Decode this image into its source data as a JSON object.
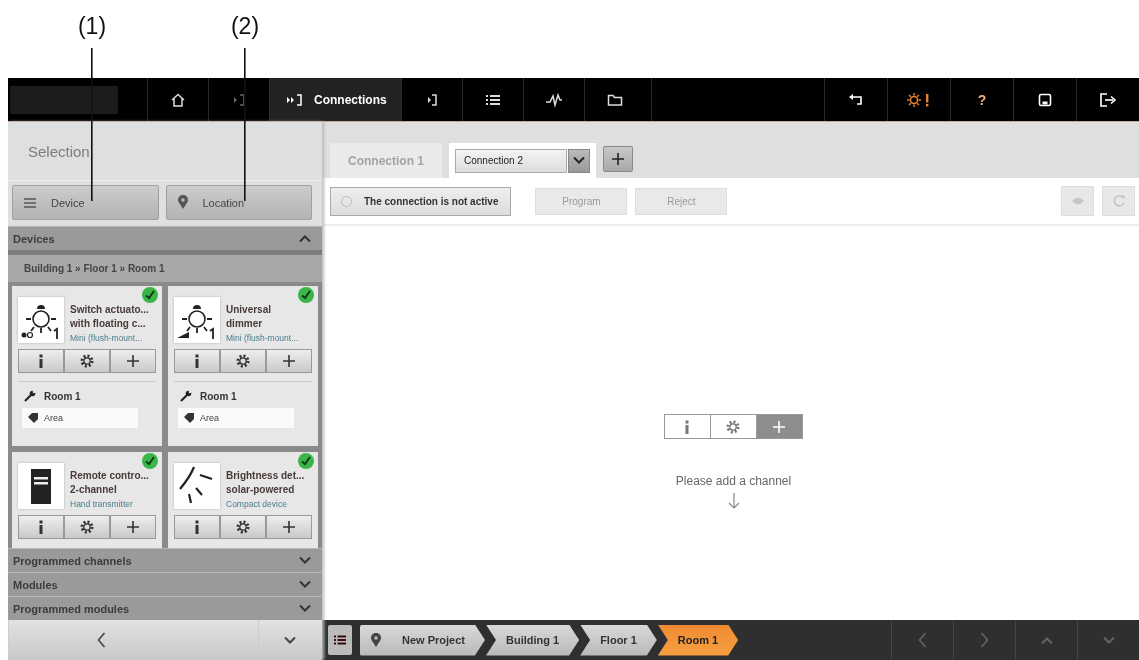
{
  "callouts": [
    {
      "label": "(1)"
    },
    {
      "label": "(2)"
    }
  ],
  "topbar": {
    "tabs": [
      {
        "kind": "home",
        "selected": false
      },
      {
        "kind": "device_in",
        "selected": false
      },
      {
        "kind": "connections",
        "label": "Connections",
        "selected": true
      },
      {
        "kind": "device_out",
        "selected": false
      },
      {
        "kind": "list",
        "selected": false
      },
      {
        "kind": "diagnostics",
        "selected": false
      },
      {
        "kind": "folder",
        "selected": false
      }
    ],
    "tools": [
      {
        "kind": "undo"
      },
      {
        "kind": "alert"
      },
      {
        "kind": "help",
        "label": "?"
      },
      {
        "kind": "save"
      },
      {
        "kind": "logout"
      }
    ]
  },
  "sidebar": {
    "title": "Selection",
    "modes": [
      {
        "kind": "device",
        "label": "Device"
      },
      {
        "kind": "location",
        "label": "Location"
      }
    ],
    "sections": [
      {
        "title": "Devices",
        "expanded": true,
        "path": "Building 1 » Floor 1 » Room 1",
        "devices": [
          {
            "kind": "switch",
            "title_lines": [
              "Switch actuato...",
              "with floating c..."
            ],
            "type": "Mini (flush-mount...",
            "programmed": true,
            "room": "Room 1",
            "area": "Area"
          },
          {
            "kind": "dimmer",
            "title_lines": [
              "Universal",
              "dimmer"
            ],
            "type": "Mini (flush-mount...",
            "programmed": true,
            "room": "Room 1",
            "area": "Area"
          },
          {
            "kind": "remote",
            "title_lines": [
              "Remote contro...",
              "2-channel"
            ],
            "type": "Hand transmitter",
            "programmed": true
          },
          {
            "kind": "sensor",
            "title_lines": [
              "Brightness det...",
              "solar-powered"
            ],
            "type": "Compact device",
            "programmed": true
          }
        ]
      },
      {
        "title": "Programmed channels",
        "expanded": false
      },
      {
        "title": "Modules",
        "expanded": false
      },
      {
        "title": "Programmed modules",
        "expanded": false
      }
    ],
    "nav": [
      {
        "kind": "back"
      },
      {
        "kind": "down"
      }
    ]
  },
  "main": {
    "tabs": [
      {
        "kind": "tab",
        "label": "Connection 1",
        "selected": false
      },
      {
        "kind": "dropdown",
        "label": "Connection 2",
        "selected": true
      }
    ],
    "status": {
      "label": "The connection is not active",
      "active": false
    },
    "actions": [
      {
        "label": "Program",
        "disabled": true
      },
      {
        "label": "Reject",
        "disabled": true
      }
    ],
    "tools": [
      {
        "kind": "view",
        "disabled": true
      },
      {
        "kind": "refresh",
        "disabled": true
      }
    ],
    "channel_buttons": [
      {
        "kind": "info",
        "selected": false
      },
      {
        "kind": "settings",
        "selected": false
      },
      {
        "kind": "add",
        "selected": true
      }
    ],
    "hint": "Please add a channel"
  },
  "bottom_bar": {
    "crumbs": [
      {
        "label": "New Project",
        "selected": false
      },
      {
        "label": "Building 1",
        "selected": false
      },
      {
        "label": "Floor 1",
        "selected": false
      },
      {
        "label": "Room 1",
        "selected": true
      }
    ],
    "nav": [
      {
        "kind": "back",
        "disabled": true
      },
      {
        "kind": "next",
        "disabled": true
      },
      {
        "kind": "up",
        "disabled": true
      },
      {
        "kind": "down",
        "disabled": true
      }
    ]
  }
}
